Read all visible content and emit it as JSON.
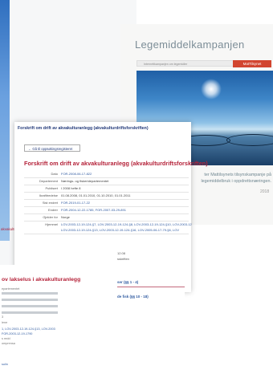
{
  "background_page": {
    "link_top": "akvakultur.og",
    "title": "ov lakselus i akvakulturanlegg",
    "meta_fragments": [
      "epartementet",
      "",
      "",
      "",
      "",
      "3",
      "lene",
      "",
      "1, LOV-2003-12-19-124-§13, LOV-2003",
      "FOR-2003-12-19-1790"
    ],
    "meta_fragment_extra": [
      "s redd",
      "omprensa"
    ],
    "footer_link": "sulin"
  },
  "campaign": {
    "logo": "Legemiddelkampanjen",
    "nav_placeholder": "Internettkampanjen om legemidler",
    "brand_button": "MatTilsynet",
    "caption_lines": [
      "ter Mattilsynets tilsynskampanje på",
      "legemiddelbruk i oppdrettsnæringen."
    ],
    "year": "2018"
  },
  "document": {
    "window_heading": "Forskrift om drift av akvakulturanlegg (akvakulturdriftsforskriften)",
    "back_button": "← Gå til oppsøkingsregisteret",
    "title": "Forskrift om drift av akvakulturanlegg (akvakulturdriftsforskriften)",
    "meta": [
      {
        "key": "Dato",
        "value": "FOR-2008-06-17-822"
      },
      {
        "key": "Departement",
        "value": "Nærings- og fiskeridepartementet"
      },
      {
        "key": "Publisert",
        "value": "I 2008 hefte 8"
      },
      {
        "key": "Ikrafttredelse",
        "value": "01.08.2008, 01.01.2010, 01.10.2010, 01.01.2011"
      },
      {
        "key": "Sist endret",
        "value": "FOR-2019-01-17-22"
      },
      {
        "key": "Endrer",
        "value": "FOR-2004-12-22-1785, FOR-2007-03-29-891"
      },
      {
        "key": "Gjelder for",
        "value": "Norge"
      },
      {
        "key": "Hjemmel",
        "value": "LOV-2003-12-19-124-§7, LOV-2003-12-19-124-§8, LOV-2003-12-19-124-§10, LOV-2003-12"
      },
      {
        "key": "",
        "value": "LOV-2003-12-19-124-§13, LOV-2003-12-19-124-§16, LOV-2005-06-17-79-§6, LOV"
      }
    ],
    "date_fragment": "12.08",
    "right_fragment": "sskriften",
    "chapter_1": "ser (§§ 1 - 4)",
    "chapter_2": "de fisk (§§ 10 - 18)"
  }
}
